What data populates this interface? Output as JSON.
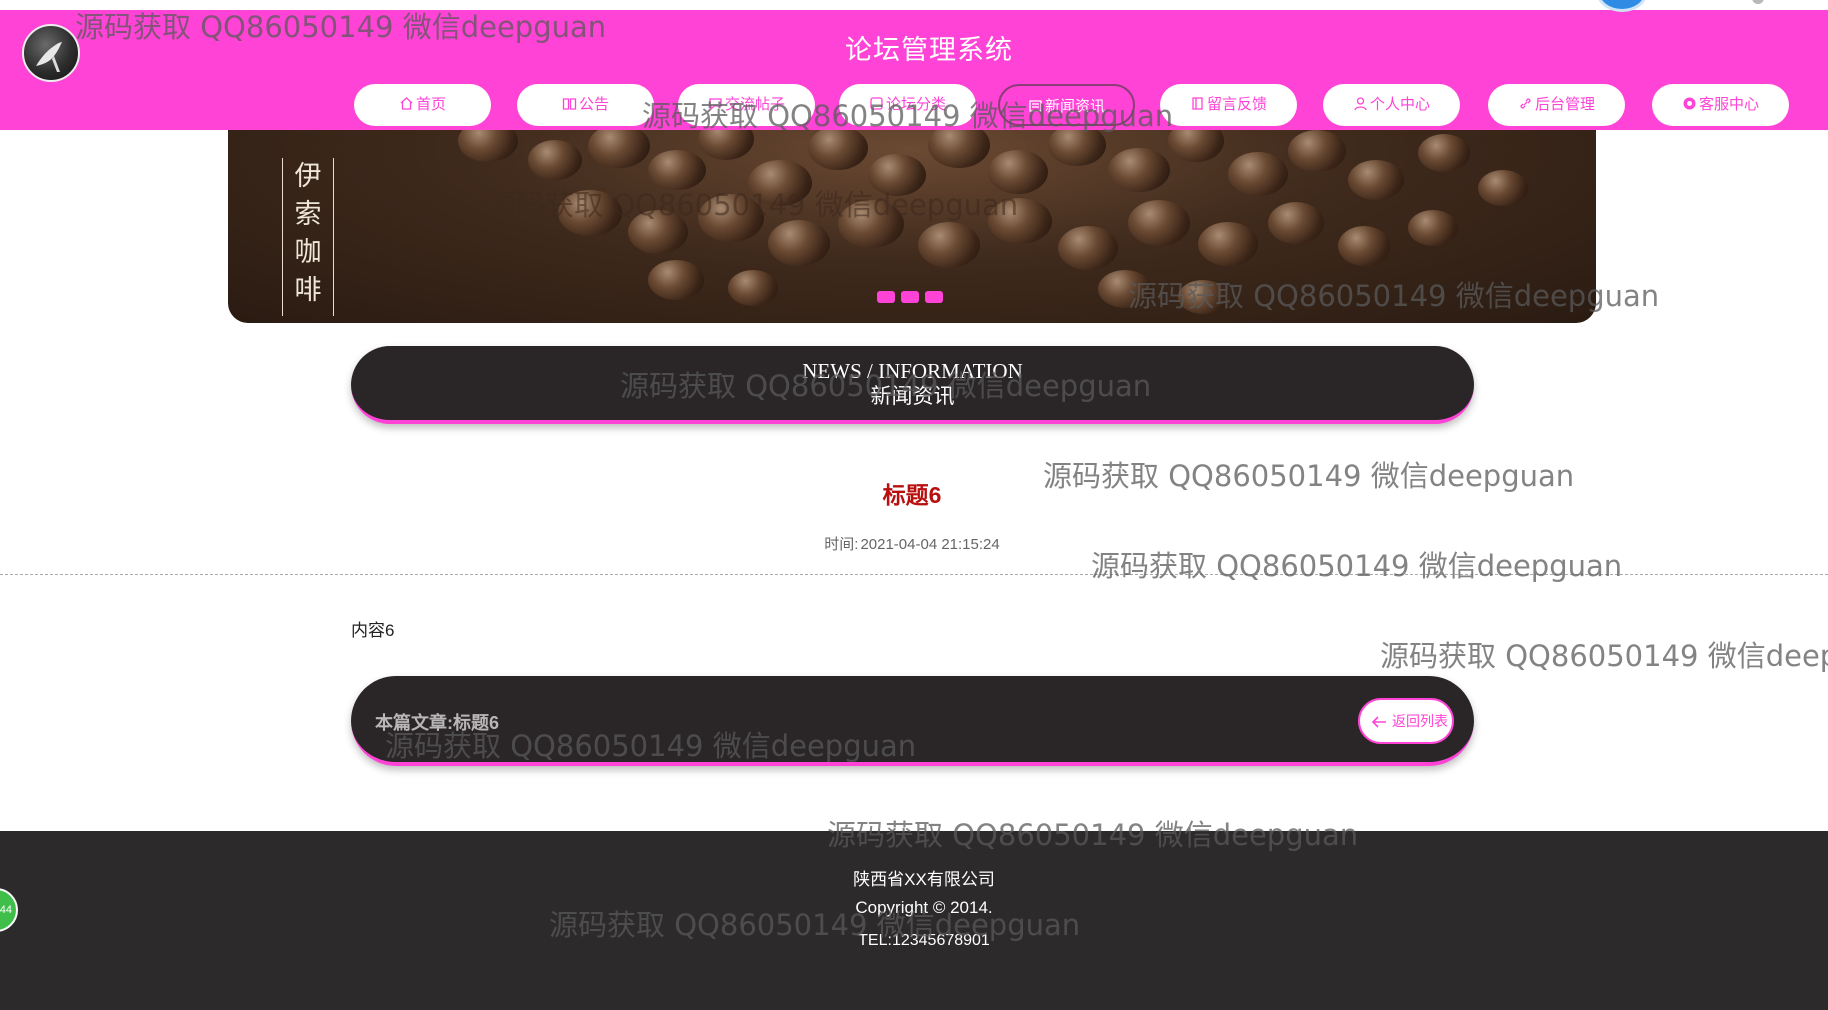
{
  "header": {
    "site_title": "论坛管理系统",
    "nav": [
      {
        "label": "首页",
        "icon": "home-icon"
      },
      {
        "label": "公告",
        "icon": "book-icon"
      },
      {
        "label": "交流帖子",
        "icon": "chat-icon"
      },
      {
        "label": "论坛分类",
        "icon": "grid-icon"
      },
      {
        "label": "新闻资讯",
        "icon": "news-icon",
        "active": true
      },
      {
        "label": "留言反馈",
        "icon": "note-icon"
      },
      {
        "label": "个人中心",
        "icon": "user-icon"
      },
      {
        "label": "后台管理",
        "icon": "link-icon"
      },
      {
        "label": "客服中心",
        "icon": "support-icon"
      }
    ],
    "accent_color": "#ff43d6"
  },
  "banner": {
    "text": [
      "伊",
      "索",
      "咖",
      "啡"
    ],
    "dot_count": 3
  },
  "section": {
    "title_en": "NEWS / INFORMATION",
    "title_zh": "新闻资讯"
  },
  "article": {
    "title": "标题6",
    "time_label": "时间:",
    "time_value": "2021-04-04 21:15:24",
    "content": "内容6",
    "current_label": "本篇文章:标题6",
    "back_label": "返回列表"
  },
  "footer": {
    "company": "陕西省XX有限公司",
    "copyright": "Copyright © 2014.",
    "tel": "TEL:12345678901"
  },
  "float_button": {
    "label": "44"
  },
  "watermark": {
    "text": "源码获取 QQ86050149 微信deepguan"
  }
}
